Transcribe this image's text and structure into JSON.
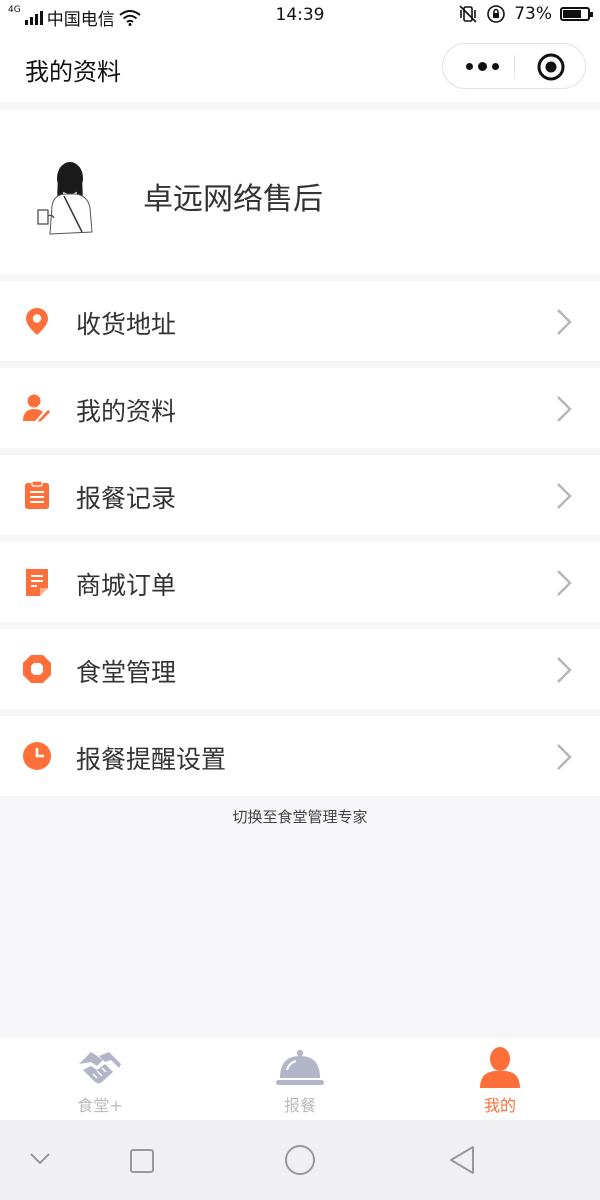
{
  "status_bar": {
    "network_type": "4G",
    "carrier": "中国电信",
    "time": "14:39",
    "battery_percent": "73%",
    "battery_level": 0.73
  },
  "nav": {
    "title": "我的资料"
  },
  "profile": {
    "name": "卓远网络售后"
  },
  "menu": [
    {
      "label": "收货地址",
      "icon": "location-pin-icon"
    },
    {
      "label": "我的资料",
      "icon": "user-edit-icon"
    },
    {
      "label": "报餐记录",
      "icon": "clipboard-icon"
    },
    {
      "label": "商城订单",
      "icon": "order-document-icon"
    },
    {
      "label": "食堂管理",
      "icon": "octagon-icon"
    },
    {
      "label": "报餐提醒设置",
      "icon": "clock-icon"
    }
  ],
  "switch_link": "切换至食堂管理专家",
  "tabs": [
    {
      "label": "食堂+",
      "icon": "handshake-icon",
      "active": false
    },
    {
      "label": "报餐",
      "icon": "food-cloche-icon",
      "active": false
    },
    {
      "label": "我的",
      "icon": "person-icon",
      "active": true
    }
  ],
  "colors": {
    "accent": "#ff6f3a",
    "tab_inactive": "#bbbbbb",
    "chevron": "#b5b5bd",
    "background": "#f6f6f8"
  }
}
